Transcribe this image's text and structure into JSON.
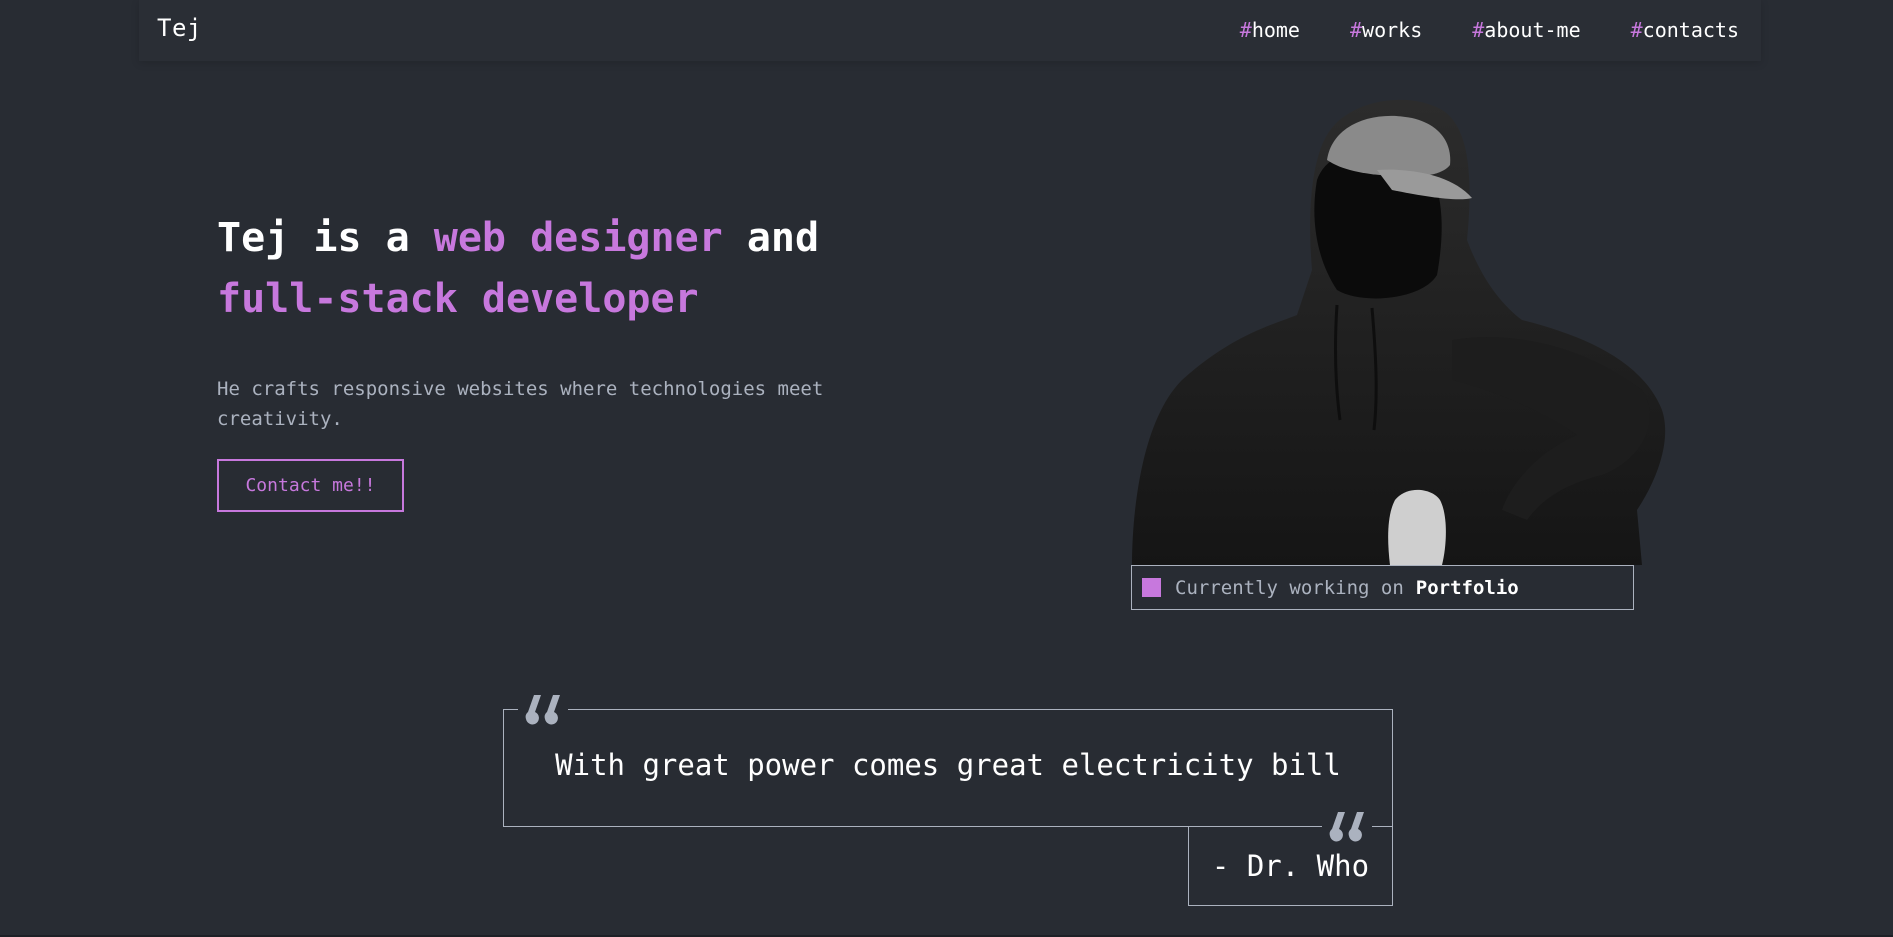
{
  "header": {
    "logo": "Tej",
    "nav": [
      {
        "hash": "#",
        "label": "home"
      },
      {
        "hash": "#",
        "label": "works"
      },
      {
        "hash": "#",
        "label": "about-me"
      },
      {
        "hash": "#",
        "label": "contacts"
      }
    ]
  },
  "hero": {
    "title_part1": "Tej is a ",
    "title_accent1": "web designer",
    "title_part2": " and",
    "title_accent2": "full-stack developer",
    "subtitle": "He crafts responsive websites where technologies meet creativity.",
    "cta_label": "Contact me!!",
    "image_alt": "Person in dark hoodie and cap, face hidden",
    "status_prefix": "Currently working on",
    "status_project": "Portfolio"
  },
  "quote": {
    "text": "With great power comes great electricity bill",
    "author": "- Dr. Who"
  },
  "colors": {
    "background": "#282c33",
    "accent": "#c778dd",
    "muted_text": "#abb2bf",
    "text": "#ffffff"
  },
  "icons": {
    "quote_open": "quote-icon",
    "quote_close": "quote-icon",
    "status": "square-icon"
  }
}
